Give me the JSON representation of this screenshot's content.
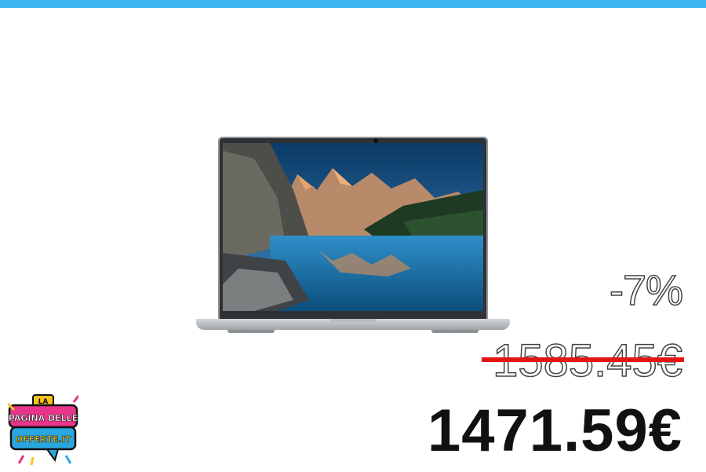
{
  "promo": {
    "discount": "-7%",
    "old_price": "1585.45€",
    "new_price": "1471.59€"
  },
  "logo": {
    "line1": "LA",
    "line2": "PAGINA DELLE",
    "line3": "OFFERTE.IT"
  },
  "colors": {
    "top_bar": "#3db4f2",
    "strike": "#e31515",
    "logo_pink": "#e8348a",
    "logo_blue": "#2aa7df",
    "logo_yellow": "#f6c21b"
  }
}
